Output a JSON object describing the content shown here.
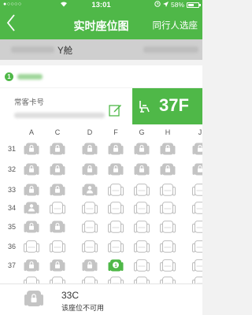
{
  "status_bar": {
    "signal_dots": "●○○○○",
    "time": "13:01",
    "battery_percent": "58%",
    "battery_level": 0.58
  },
  "nav": {
    "title": "实时座位图",
    "action_label": "同行人选座",
    "back_icon": "chevron-left-icon"
  },
  "flight": {
    "cabin": "Y舱"
  },
  "passenger": {
    "index": "1"
  },
  "card": {
    "label": "常客卡号",
    "edit_icon": "edit-icon"
  },
  "selected": {
    "seat": "37F"
  },
  "seatmap": {
    "columns": [
      "A",
      "C",
      "D",
      "F",
      "G",
      "H",
      "J"
    ],
    "rows": [
      {
        "number": "31",
        "seats": [
          "unavailable",
          "unavailable",
          "unavailable",
          "unavailable",
          "unavailable",
          "unavailable",
          "unavailable"
        ]
      },
      {
        "number": "32",
        "seats": [
          "unavailable",
          "unavailable",
          "unavailable",
          "unavailable",
          "unavailable",
          "unavailable",
          "unavailable"
        ]
      },
      {
        "number": "33",
        "seats": [
          "unavailable",
          "unavailable",
          "occupied",
          "available",
          "available",
          "available",
          "available"
        ]
      },
      {
        "number": "34",
        "seats": [
          "occupied",
          "available",
          "available",
          "available",
          "available",
          "available",
          "available"
        ]
      },
      {
        "number": "35",
        "seats": [
          "unavailable",
          "unavailable",
          "available",
          "available",
          "available",
          "available",
          "available"
        ]
      },
      {
        "number": "36",
        "seats": [
          "available",
          "available",
          "available",
          "available",
          "available",
          "available",
          "available"
        ]
      },
      {
        "number": "37",
        "seats": [
          "unavailable",
          "unavailable",
          "unavailable",
          "selected",
          "available",
          "available",
          "available"
        ]
      },
      {
        "number": "",
        "seats": [
          "available",
          "available",
          "available",
          "available",
          "available",
          "available",
          "available"
        ]
      }
    ],
    "selected_marker": "1"
  },
  "info": {
    "seat": "33C",
    "status_text": "该座位不可用"
  },
  "colors": {
    "accent": "#4fb848",
    "seat_gray": "#c4c4c4",
    "seat_available": "#bdbdbd"
  }
}
